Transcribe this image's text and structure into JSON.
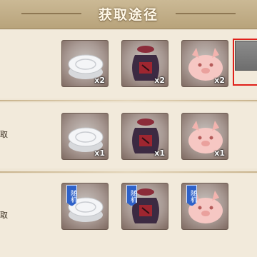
{
  "header": {
    "title": "获取途径"
  },
  "rows": [
    {
      "label": "",
      "items": [
        {
          "icon": "mooncake-icon",
          "qty": "x2",
          "badge": ""
        },
        {
          "icon": "wine-jar-icon",
          "qty": "x2",
          "badge": ""
        },
        {
          "icon": "pig-bun-icon",
          "qty": "x2",
          "badge": ""
        }
      ]
    },
    {
      "label": "取",
      "items": [
        {
          "icon": "mooncake-icon",
          "qty": "x1",
          "badge": ""
        },
        {
          "icon": "wine-jar-icon",
          "qty": "x1",
          "badge": ""
        },
        {
          "icon": "pig-bun-icon",
          "qty": "x1",
          "badge": ""
        }
      ]
    },
    {
      "label": "取",
      "items": [
        {
          "icon": "mooncake-icon",
          "qty": "",
          "badge": "随机"
        },
        {
          "icon": "wine-jar-icon",
          "qty": "",
          "badge": "随机"
        },
        {
          "icon": "pig-bun-icon",
          "qty": "",
          "badge": "随机"
        }
      ]
    }
  ],
  "colors": {
    "highlight": "#e0201a",
    "badge": "#2f62c9",
    "header": "#b8a37b"
  }
}
